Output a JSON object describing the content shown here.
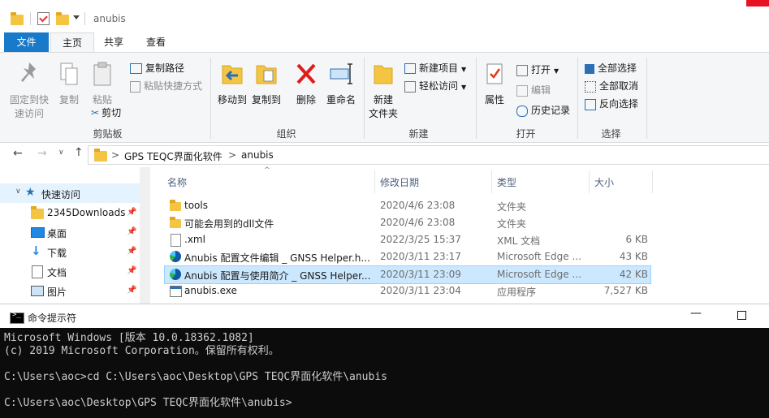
{
  "titlebar": {
    "title": "anubis"
  },
  "tabs": [
    {
      "label": "文件"
    },
    {
      "label": "主页"
    },
    {
      "label": "共享"
    },
    {
      "label": "查看"
    }
  ],
  "ribbon": {
    "clipboard": {
      "pin_label_1": "固定到快",
      "pin_label_2": "速访问",
      "copy_label": "复制",
      "paste_label": "粘贴",
      "copy_path": "复制路径",
      "paste_shortcut": "粘贴快捷方式",
      "cut": "剪切",
      "group": "剪贴板"
    },
    "organize": {
      "move_to": "移动到",
      "copy_to": "复制到",
      "delete": "删除",
      "rename": "重命名",
      "group": "组织"
    },
    "new": {
      "new_folder_1": "新建",
      "new_folder_2": "文件夹",
      "new_item": "新建项目",
      "easy_access": "轻松访问",
      "group": "新建"
    },
    "open": {
      "properties": "属性",
      "open": "打开",
      "edit": "编辑",
      "history": "历史记录",
      "group": "打开"
    },
    "select": {
      "select_all": "全部选择",
      "select_none": "全部取消",
      "invert": "反向选择",
      "group": "选择"
    }
  },
  "address": {
    "crumbs": [
      "GPS TEQC界面化软件",
      "anubis"
    ],
    "sep": ">"
  },
  "nav": {
    "items": [
      {
        "label": "快速访问"
      },
      {
        "label": "2345Downloads"
      },
      {
        "label": "桌面"
      },
      {
        "label": "下载"
      },
      {
        "label": "文档"
      },
      {
        "label": "图片"
      }
    ]
  },
  "columns": {
    "name": "名称",
    "date": "修改日期",
    "type": "类型",
    "size": "大小"
  },
  "files": [
    {
      "name": "tools",
      "date": "2020/4/6 23:08",
      "type": "文件夹",
      "size": ""
    },
    {
      "name": "可能会用到的dll文件",
      "date": "2020/4/6 23:08",
      "type": "文件夹",
      "size": ""
    },
    {
      "name": ".xml",
      "date": "2022/3/25 15:37",
      "type": "XML 文档",
      "size": "6 KB"
    },
    {
      "name": "Anubis 配置文件编辑 _ GNSS Helper.h...",
      "date": "2020/3/11 23:17",
      "type": "Microsoft Edge ...",
      "size": "43 KB"
    },
    {
      "name": "Anubis 配置与使用简介 _ GNSS Helper...",
      "date": "2020/3/11 23:09",
      "type": "Microsoft Edge ...",
      "size": "42 KB"
    },
    {
      "name": "anubis.exe",
      "date": "2020/3/11 23:04",
      "type": "应用程序",
      "size": "7,527 KB"
    }
  ],
  "cmd": {
    "title": "命令提示符",
    "lines": [
      "Microsoft Windows [版本 10.0.18362.1082]",
      "(c) 2019 Microsoft Corporation。保留所有权利。",
      "",
      "C:\\Users\\aoc>cd C:\\Users\\aoc\\Desktop\\GPS TEQC界面化软件\\anubis",
      "",
      "C:\\Users\\aoc\\Desktop\\GPS TEQC界面化软件\\anubis>"
    ]
  },
  "colors": {
    "accent": "#1979ca",
    "selected": "#cce8ff",
    "cmd_bg": "#0c0c0c",
    "folder": "#f4c542"
  }
}
